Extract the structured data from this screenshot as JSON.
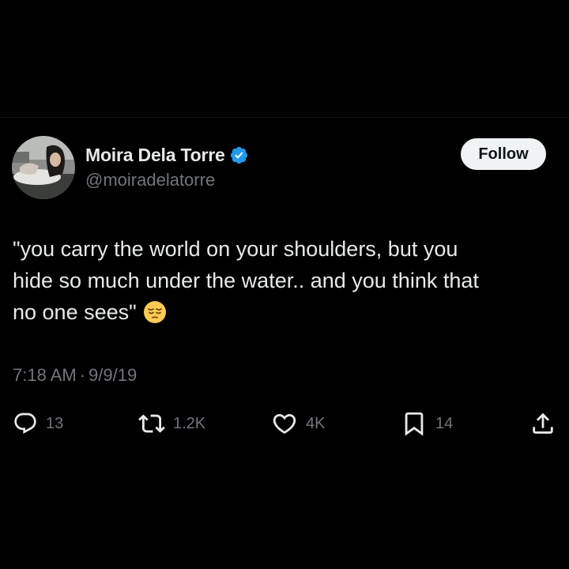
{
  "tweet": {
    "author": {
      "display_name": "Moira Dela Torre",
      "handle": "@moiradelatorre",
      "verified": true
    },
    "follow_label": "Follow",
    "text_lines": [
      "\"you carry the world on your shoulders, but you",
      "hide so much under the water.. and you think that",
      "no one sees\""
    ],
    "emoji": "pensive-face",
    "time": "7:18 AM",
    "separator": "·",
    "date": "9/9/19",
    "stats": {
      "replies": "13",
      "reposts": "1.2K",
      "likes": "4K",
      "bookmarks": "14"
    }
  },
  "colors": {
    "background": "#000000",
    "text_primary": "#e7e9ea",
    "text_secondary": "#71767b",
    "verified_badge": "#1d9bf0",
    "follow_button_bg": "#eff3f4",
    "follow_button_text": "#0f1419"
  },
  "icons": {
    "reply": "reply-bubble-icon",
    "repost": "repost-arrows-icon",
    "like": "heart-icon",
    "bookmark": "bookmark-icon",
    "share": "share-upload-icon"
  }
}
